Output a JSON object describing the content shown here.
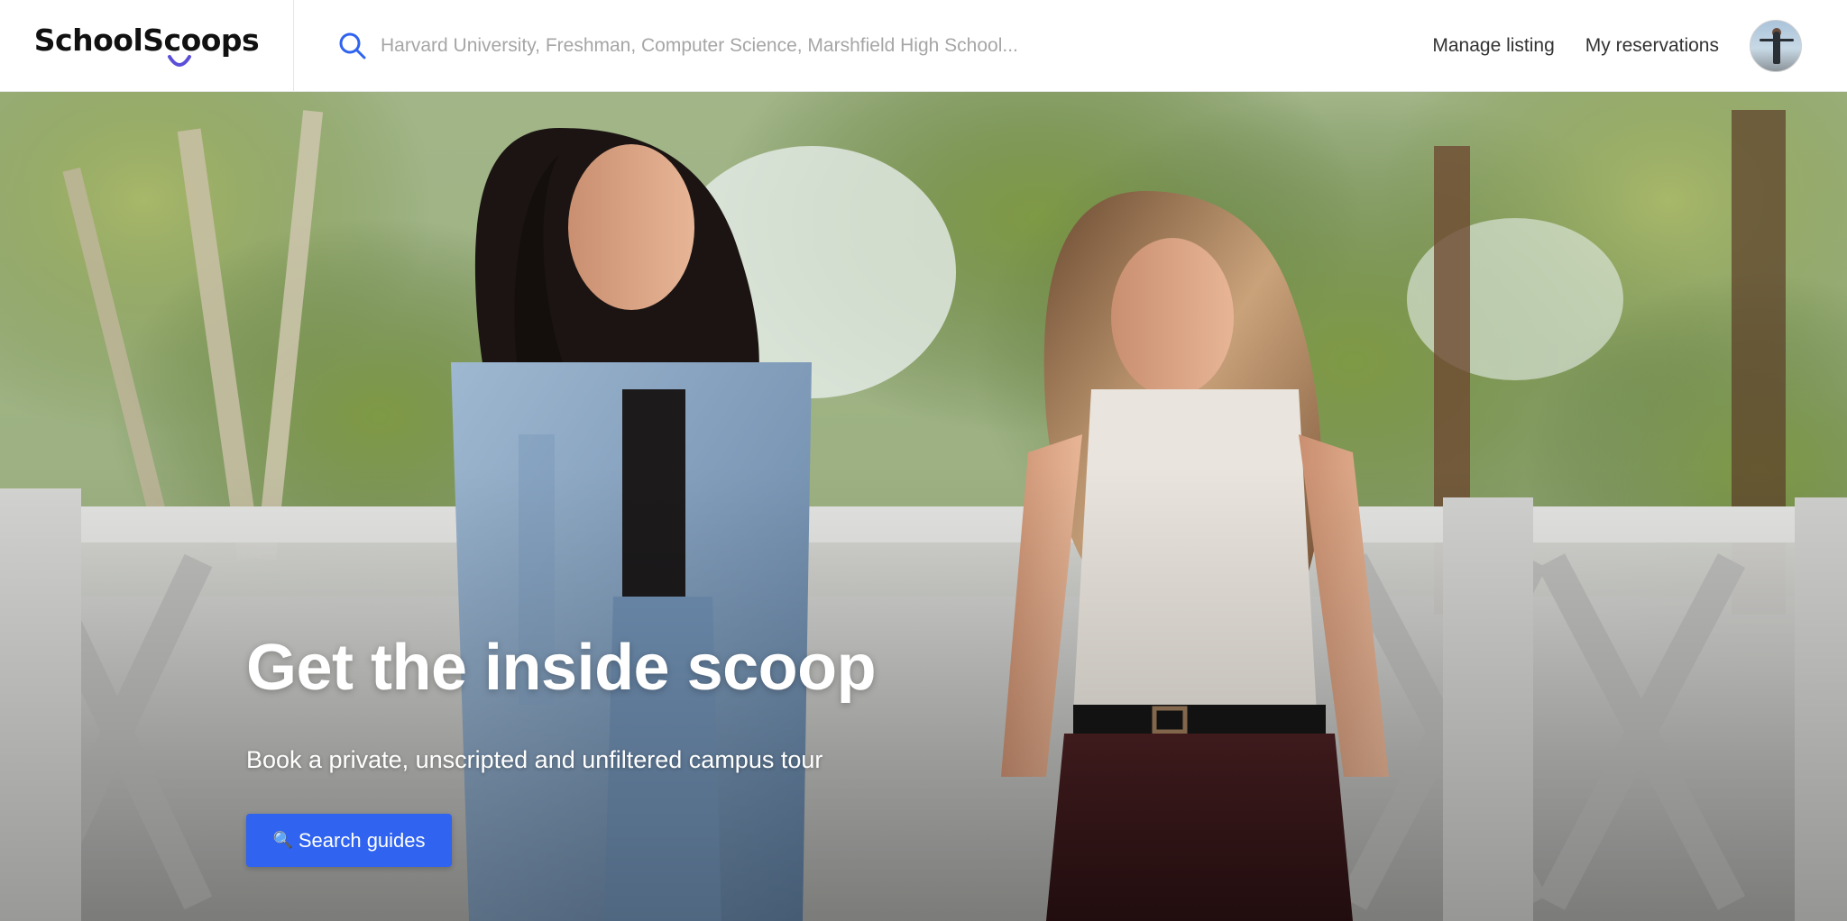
{
  "header": {
    "logo_text": "SchoolScoops",
    "search": {
      "icon": "search-icon",
      "placeholder": "Harvard University, Freshman, Computer Science, Marshfield High School...",
      "value": ""
    },
    "nav": {
      "manage_listing": "Manage listing",
      "my_reservations": "My reservations"
    },
    "avatar": "user-avatar"
  },
  "hero": {
    "title": "Get the inside scoop",
    "subtitle": "Book a private, unscripted and unfiltered campus tour",
    "cta": {
      "icon": "🔍",
      "label": "Search guides"
    }
  },
  "colors": {
    "brand_accent": "#5b4fd8",
    "search_icon": "#2f63f0",
    "cta_background": "#2f63f0",
    "header_text": "#333333",
    "placeholder": "#a6a6a6"
  }
}
